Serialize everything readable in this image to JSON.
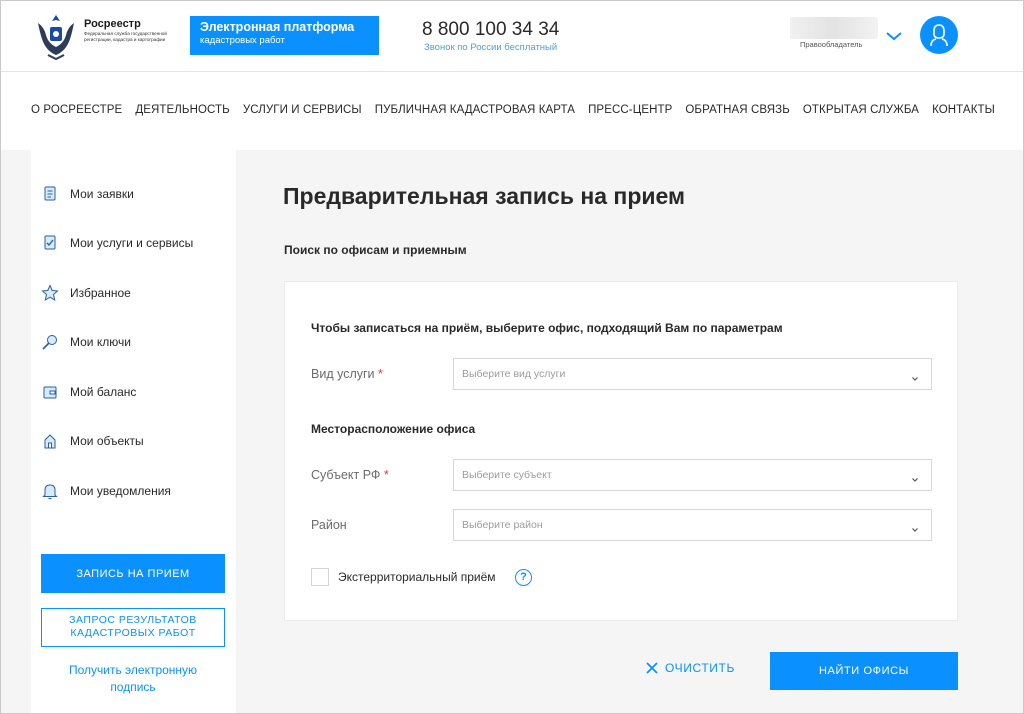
{
  "header": {
    "logo_title": "Росреестр",
    "logo_subtitle": "Федеральная служба государственной регистрации, кадастра и картографии",
    "platform_title": "Электронная платформа",
    "platform_subtitle": "кадастровых работ",
    "phone": "8 800 100 34 34",
    "phone_caption": "Звонок по России бесплатный",
    "user_role": "Правообладатель"
  },
  "nav": {
    "items": [
      "О РОСРЕЕСТРЕ",
      "ДЕЯТЕЛЬНОСТЬ",
      "УСЛУГИ И СЕРВИСЫ",
      "ПУБЛИЧНАЯ КАДАСТРОВАЯ КАРТА",
      "ПРЕСС-ЦЕНТР",
      "ОБРАТНАЯ СВЯЗЬ",
      "ОТКРЫТАЯ СЛУЖБА",
      "КОНТАКТЫ"
    ]
  },
  "sidebar": {
    "items": [
      {
        "label": "Мои заявки",
        "icon": "document-icon"
      },
      {
        "label": "Мои услуги и сервисы",
        "icon": "checklist-icon"
      },
      {
        "label": "Избранное",
        "icon": "star-icon"
      },
      {
        "label": "Мои ключи",
        "icon": "key-icon"
      },
      {
        "label": "Мой баланс",
        "icon": "wallet-icon"
      },
      {
        "label": "Мои объекты",
        "icon": "house-icon"
      },
      {
        "label": "Мои уведомления",
        "icon": "bell-icon"
      }
    ],
    "primary_button": "ЗАПИСЬ НА ПРИЕМ",
    "outline_button_line1": "ЗАПРОС РЕЗУЛЬТАТОВ",
    "outline_button_line2": "КАДАСТРОВЫХ РАБОТ",
    "link_line1": "Получить электронную",
    "link_line2": "подпись"
  },
  "main": {
    "title": "Предварительная запись на прием",
    "search_label": "Поиск по офисам и приемным",
    "card_heading": "Чтобы записаться на приём, выберите офис, подходящий Вам по параметрам",
    "service_label": "Вид услуги",
    "service_placeholder": "Выберите вид услуги",
    "location_heading": "Месторасположение офиса",
    "subject_label": "Субъект РФ",
    "subject_placeholder": "Выберите субъект",
    "district_label": "Район",
    "district_placeholder": "Выберите район",
    "required_mark": "*",
    "extraterritorial_label": "Экстерриториальный приём",
    "help_symbol": "?",
    "clear_button": "ОЧИСТИТЬ",
    "find_button": "НАЙТИ ОФИСЫ"
  },
  "colors": {
    "accent": "#0b91ff",
    "required": "#e03b3b"
  }
}
